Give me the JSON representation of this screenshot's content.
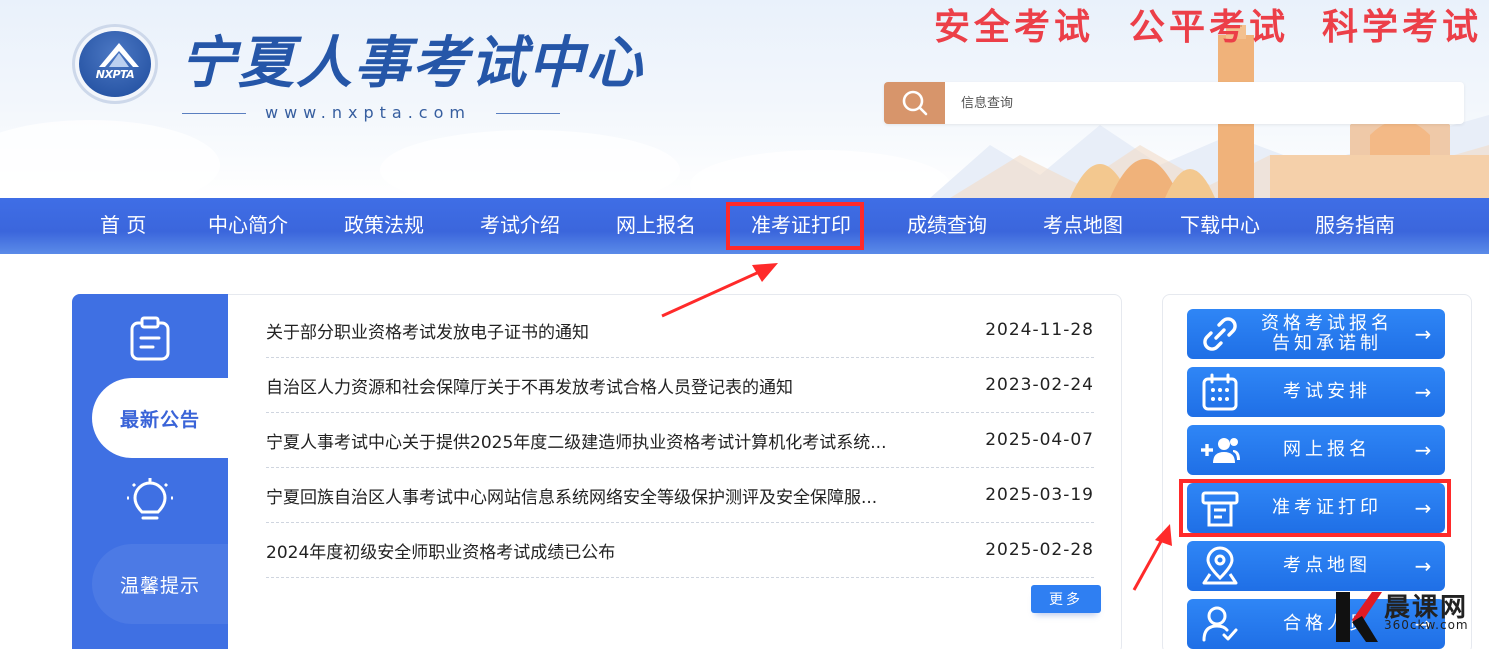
{
  "header": {
    "site_title": "宁夏人事考试中心",
    "site_url": "www.nxpta.com",
    "logo_abbr": "NXPTA",
    "slogans": [
      "安全考试",
      "公平考试",
      "科学考试"
    ],
    "search": {
      "placeholder": "信息查询"
    },
    "colors": {
      "slogan": "#ec3f48",
      "title": "#2556a8",
      "search_button": "#d7956b"
    }
  },
  "nav": {
    "items": [
      "首  页",
      "中心简介",
      "政策法规",
      "考试介绍",
      "网上报名",
      "准考证打印",
      "成绩查询",
      "考点地图",
      "下载中心",
      "服务指南"
    ],
    "highlighted": "准考证打印",
    "color": "#3f6ee6"
  },
  "notices": {
    "tabs": {
      "active": "最新公告",
      "inactive": "温馨提示"
    },
    "items": [
      {
        "title": "关于部分职业资格考试发放电子证书的通知",
        "date": "2024-11-28"
      },
      {
        "title": "自治区人力资源和社会保障厅关于不再发放考试合格人员登记表的通知",
        "date": "2023-02-24"
      },
      {
        "title": "宁夏人事考试中心关于提供2025年度二级建造师执业资格考试计算机化考试系统...",
        "date": "2025-04-07"
      },
      {
        "title": "宁夏回族自治区人事考试中心网站信息系统网络安全等级保护测评及安全保障服...",
        "date": "2025-03-19"
      },
      {
        "title": "2024年度初级安全师职业资格考试成绩已公布",
        "date": "2025-02-28"
      }
    ],
    "more": "更多"
  },
  "quick_links": {
    "items": [
      {
        "label_line1": "资格考试报名",
        "label_line2": "告知承诺制",
        "icon": "link-icon"
      },
      {
        "label_line1": "考试安排",
        "label_line2": "",
        "icon": "calendar-icon"
      },
      {
        "label_line1": "网上报名",
        "label_line2": "",
        "icon": "add-user-icon"
      },
      {
        "label_line1": "准考证打印",
        "label_line2": "",
        "icon": "printer-icon"
      },
      {
        "label_line1": "考点地图",
        "label_line2": "",
        "icon": "map-pin-icon"
      },
      {
        "label_line1": "合格人员",
        "label_line2": "",
        "icon": "user-check-icon"
      }
    ],
    "arrow": "→",
    "highlighted": "准考证打印",
    "color": "#2f86f6"
  },
  "annotations": {
    "highlight_color": "#ff2a2a"
  },
  "watermark": {
    "text": "晨课网",
    "sub": "360ckw.com",
    "logo_letter": "K"
  }
}
